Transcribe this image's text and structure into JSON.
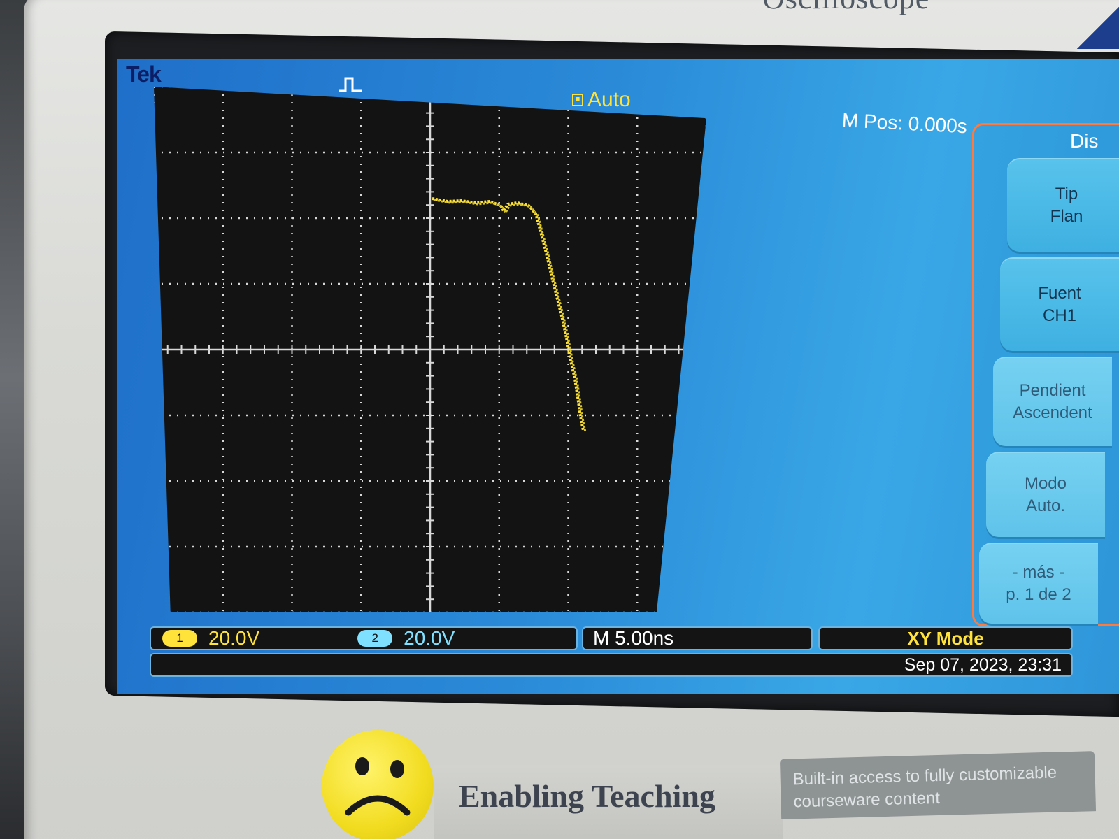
{
  "instrument": {
    "brand_top": "Oscilloscope",
    "slogan": "Enabling Teaching",
    "courseware_line1": "Built-in access to fully customizable",
    "courseware_line2": "courseware content"
  },
  "screen": {
    "logo": "Tek",
    "trigger_icon": "trigger-pulse-icon",
    "acq_state_icon": "stop-square-icon",
    "acq_state_icon_glyph": "■",
    "trigger_mode": "Auto",
    "horizontal_position": "M Pos: 0.000s",
    "side_menu": {
      "title": "Dis",
      "buttons": [
        {
          "line1": "Tip",
          "line2": "Flan"
        },
        {
          "line1": "Fuent",
          "line2": "CH1"
        },
        {
          "line1": "Pendient",
          "line2": "Ascendent"
        },
        {
          "line1": "Modo",
          "line2": "Auto."
        },
        {
          "line1": "- más -",
          "line2": "p. 1 de 2"
        }
      ]
    },
    "status": {
      "ch1_badge": "1",
      "ch1_scale": "20.0V",
      "ch2_badge": "2",
      "ch2_scale": "20.0V",
      "timebase": "M 5.00ns",
      "display_mode": "XY Mode",
      "datetime": "Sep 07, 2023, 23:31"
    },
    "colors": {
      "ch1": "#ffe23a",
      "ch2": "#7fe0ff",
      "screen_bg": "#2a8ad8",
      "menu_border": "#ff7a3c"
    }
  }
}
